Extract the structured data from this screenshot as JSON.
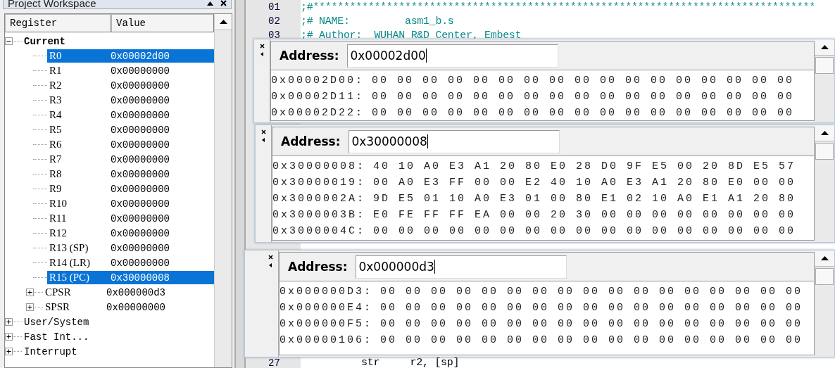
{
  "workspace": {
    "title": "Project Workspace",
    "columns": [
      "Register",
      "Value"
    ],
    "tree": [
      {
        "label": "Current",
        "expanded": true,
        "selected": false,
        "children": [
          {
            "label": "R0",
            "value": "0x00002d00",
            "selected": true
          },
          {
            "label": "R1",
            "value": "0x00000000",
            "selected": false
          },
          {
            "label": "R2",
            "value": "0x00000000",
            "selected": false
          },
          {
            "label": "R3",
            "value": "0x00000000",
            "selected": false
          },
          {
            "label": "R4",
            "value": "0x00000000",
            "selected": false
          },
          {
            "label": "R5",
            "value": "0x00000000",
            "selected": false
          },
          {
            "label": "R6",
            "value": "0x00000000",
            "selected": false
          },
          {
            "label": "R7",
            "value": "0x00000000",
            "selected": false
          },
          {
            "label": "R8",
            "value": "0x00000000",
            "selected": false
          },
          {
            "label": "R9",
            "value": "0x00000000",
            "selected": false
          },
          {
            "label": "R10",
            "value": "0x00000000",
            "selected": false
          },
          {
            "label": "R11",
            "value": "0x00000000",
            "selected": false
          },
          {
            "label": "R12",
            "value": "0x00000000",
            "selected": false
          },
          {
            "label": "R13 (SP)",
            "value": "0x00000000",
            "selected": false
          },
          {
            "label": "R14 (LR)",
            "value": "0x00000000",
            "selected": false
          },
          {
            "label": "R15 (PC)",
            "value": "0x30000008",
            "selected": true
          },
          {
            "label": "CPSR",
            "value": "0x000000d3",
            "expanded": false,
            "selected": false
          },
          {
            "label": "SPSR",
            "value": "0x00000000",
            "expanded": false,
            "selected": false
          }
        ]
      },
      {
        "label": "User/System",
        "expanded": false,
        "selected": false
      },
      {
        "label": "Fast Int...",
        "expanded": false,
        "selected": false
      },
      {
        "label": "Interrupt",
        "expanded": false,
        "selected": false
      }
    ]
  },
  "editor": {
    "top_lines": [
      {
        "number": "01",
        "text": ";#**********************************************************************************"
      },
      {
        "number": "02",
        "text": ";# NAME:         asm1_b.s"
      },
      {
        "number": "03",
        "text": ";# Author:  WUHAN R&D Center, Embest"
      }
    ],
    "bottom_lines": [
      {
        "number": "27",
        "text": "str     r2, [sp]"
      }
    ]
  },
  "memory_windows": [
    {
      "label": "Address:",
      "address": "0x00002d00",
      "rows": [
        {
          "address": "0x00002D00:",
          "bytes": "00 00 00 00 00 00 00 00 00 00 00 00 00 00 00 00 00"
        },
        {
          "address": "0x00002D11:",
          "bytes": "00 00 00 00 00 00 00 00 00 00 00 00 00 00 00 00 00"
        },
        {
          "address": "0x00002D22:",
          "bytes": "00 00 00 00 00 00 00 00 00 00 00 00 00 00 00 00 00"
        }
      ]
    },
    {
      "label": "Address:",
      "address": "0x30000008",
      "rows": [
        {
          "address": "0x30000008:",
          "bytes": "40 10 A0 E3 A1 20 80 E0 28 D0 9F E5 00 20 8D E5 57"
        },
        {
          "address": "0x30000019:",
          "bytes": "00 A0 E3 FF 00 00 E2 40 10 A0 E3 A1 20 80 E0 00 00"
        },
        {
          "address": "0x3000002A:",
          "bytes": "9D E5 01 10 A0 E3 01 00 80 E1 02 10 A0 E1 A1 20 80"
        },
        {
          "address": "0x3000003B:",
          "bytes": "E0 FE FF FF EA 00 00 20 30 00 00 00 00 00 00 00 00"
        },
        {
          "address": "0x3000004C:",
          "bytes": "00 00 00 00 00 00 00 00 00 00 00 00 00 00 00 00 00"
        }
      ]
    },
    {
      "label": "Address:",
      "address": "0x000000d3",
      "rows": [
        {
          "address": "0x000000D3:",
          "bytes": "00 00 00 00 00 00 00 00 00 00 00 00 00 00 00 00 00"
        },
        {
          "address": "0x000000E4:",
          "bytes": "00 00 00 00 00 00 00 00 00 00 00 00 00 00 00 00 00"
        },
        {
          "address": "0x000000F5:",
          "bytes": "00 00 00 00 00 00 00 00 00 00 00 00 00 00 00 00 00"
        },
        {
          "address": "0x00000106:",
          "bytes": "00 00 00 00 00 00 00 00 00 00 00 00 00 00 00 00 00"
        }
      ]
    }
  ]
}
